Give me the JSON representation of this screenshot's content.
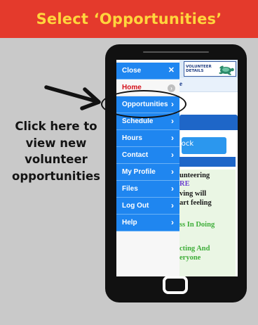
{
  "banner": {
    "title": "Select ‘Opportunities’"
  },
  "caption": {
    "lines": [
      "Click here to",
      "view new",
      "volunteer",
      "opportunities"
    ]
  },
  "menu": {
    "close_label": "Close",
    "close_icon": "close-icon",
    "items": [
      {
        "label": "Home",
        "active": true
      },
      {
        "label": "Opportunities"
      },
      {
        "label": "Schedule"
      },
      {
        "label": "Hours"
      },
      {
        "label": "Contact"
      },
      {
        "label": "My Profile"
      },
      {
        "label": "Files"
      },
      {
        "label": "Log Out"
      },
      {
        "label": "Help"
      }
    ]
  },
  "background_page": {
    "logo_text": "VOLUNTEER DETAILS",
    "strip_text": "e",
    "button_text": "lock",
    "lines": [
      "unteering",
      "RE",
      "ving will",
      "art feeling",
      "ss In Doing",
      "cting And",
      "eryone"
    ]
  },
  "colors": {
    "banner": "#e43a2c",
    "banner_text": "#ffd53d",
    "menu_blue": "#1f86f0",
    "home_red": "#d4101a"
  }
}
